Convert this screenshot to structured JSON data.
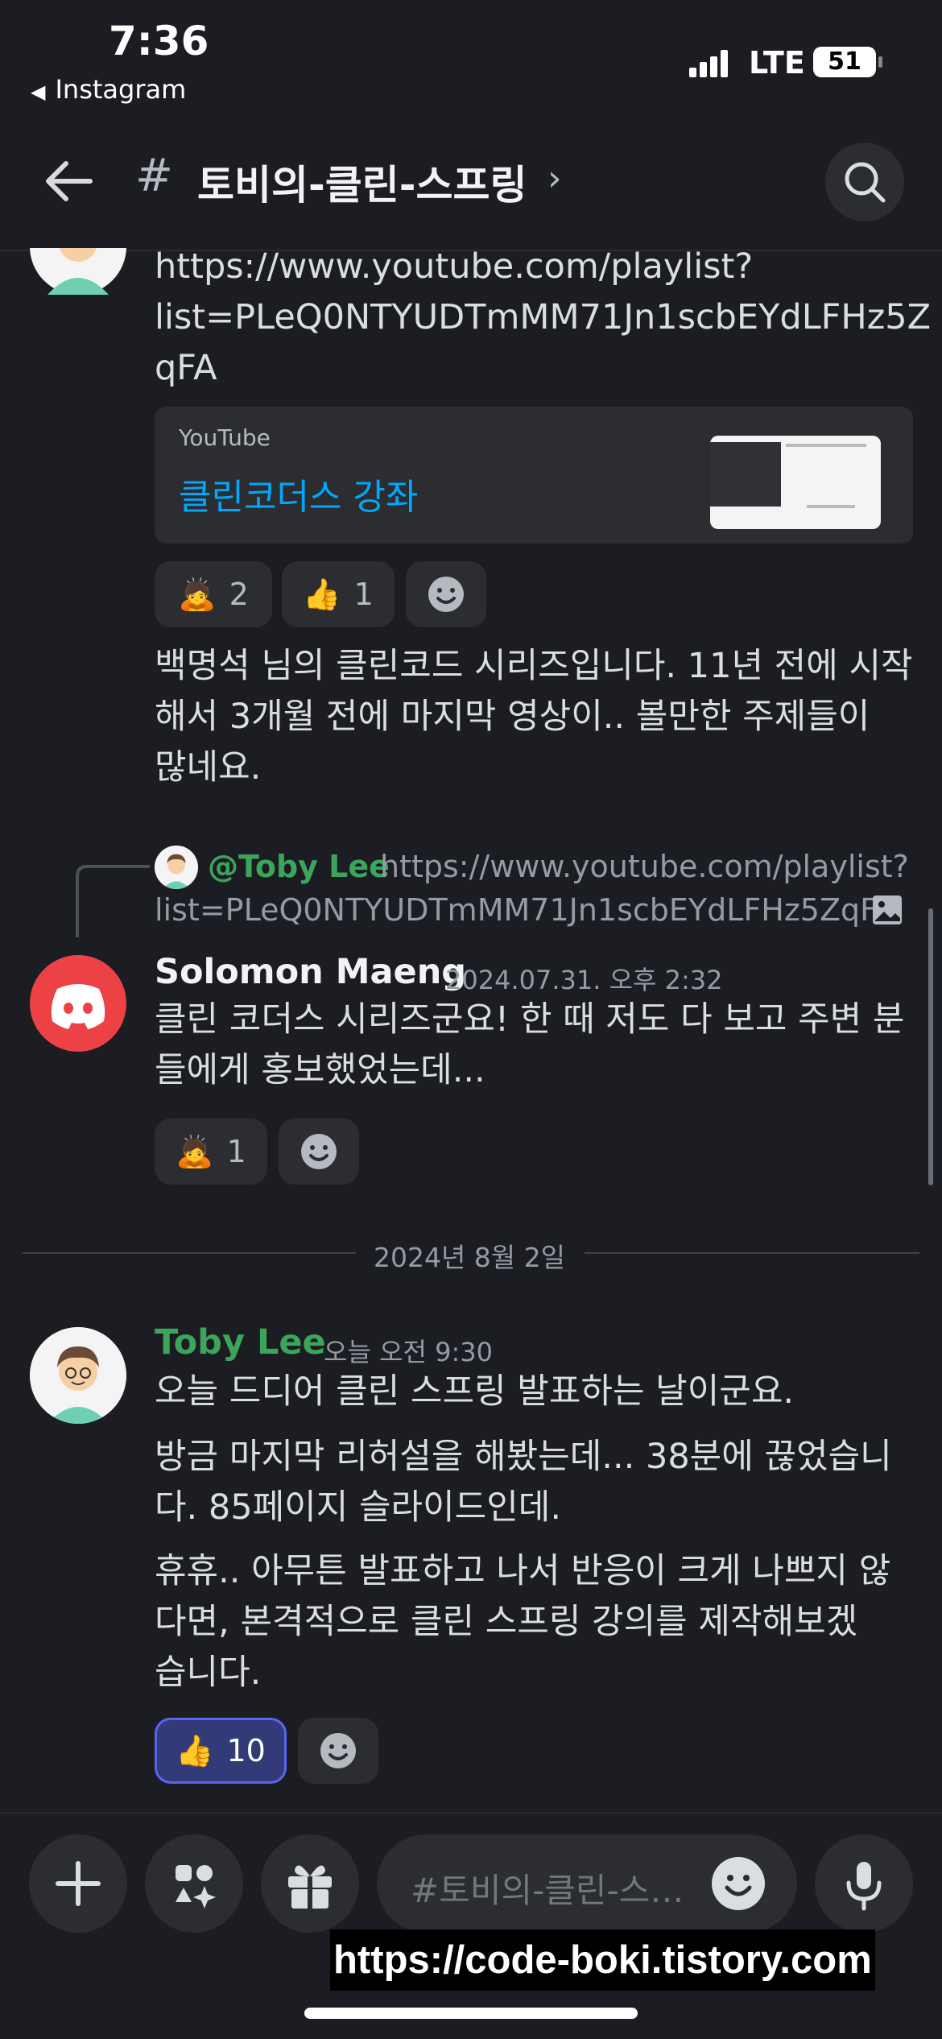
{
  "status_bar": {
    "time": "7:36",
    "back_app": "Instagram",
    "network": "LTE",
    "battery": "51"
  },
  "header": {
    "hash": "#",
    "channel_name": "토비의-클린-스프링",
    "chevron": "›"
  },
  "message1": {
    "link_lines": [
      "https://www.youtube.com/playlist?",
      "list=PLeQ0NTYUDTmMM71Jn1scbEYdLFHz5Z",
      "qFA"
    ],
    "embed": {
      "provider": "YouTube",
      "title": "클린코더스 강좌"
    },
    "reactions": [
      {
        "emoji": "🙇",
        "count": "2"
      },
      {
        "emoji": "👍",
        "count": "1"
      }
    ],
    "text_lines": [
      "백명석 님의 클린코드 시리즈입니다. 11년 전에 시작",
      "해서 3개월 전에 마지막 영상이.. 볼만한 주제들이",
      "많네요."
    ]
  },
  "reply": {
    "mention": "@Toby Lee",
    "preview_line1": "https://www.youtube.com/playlist?",
    "preview_line2": "list=PLeQ0NTYUDTmMM71Jn1scbEYdLFHz5ZqFA"
  },
  "message2": {
    "author": "Solomon Maeng",
    "timestamp": "2024.07.31. 오후 2:32",
    "text_lines": [
      "클린 코더스 시리즈군요! 한 때 저도 다 보고 주변 분",
      "들에게 홍보했었는데..."
    ],
    "reactions": [
      {
        "emoji": "🙇",
        "count": "1"
      }
    ]
  },
  "date_divider": "2024년 8월 2일",
  "message3": {
    "author": "Toby Lee",
    "timestamp": "오늘 오전 9:30",
    "text_lines": [
      "오늘 드디어 클린 스프링 발표하는 날이군요.",
      "방금 마지막 리허설을 해봤는데... 38분에 끊었습니",
      "다. 85페이지 슬라이드인데.",
      "휴휴.. 아무튼 발표하고 나서 반응이 크게 나쁘지 않",
      "다면, 본격적으로  클린 스프링 강의를 제작해보겠",
      "습니다."
    ],
    "reactions": [
      {
        "emoji": "👍",
        "count": "10"
      }
    ]
  },
  "composer": {
    "placeholder": "#토비의-클린-스프링에 메시지 보내기"
  },
  "watermark": "https://code-boki.tistory.com",
  "colors": {
    "background": "#1c1d22",
    "link": "#00a8fc",
    "toby_name": "#3ba55c",
    "discord_red": "#ed4245"
  }
}
